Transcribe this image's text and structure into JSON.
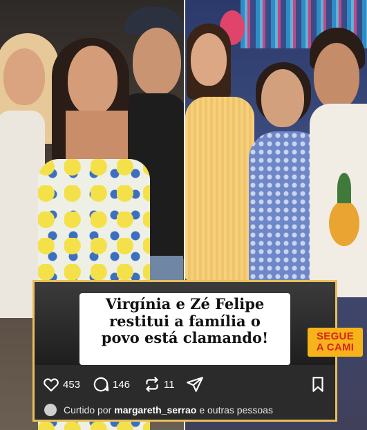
{
  "post": {
    "headline_line1": "Virgínia e Zé Felipe",
    "headline_line2": "restitui a família o",
    "headline_line3": "povo está clamando!",
    "likes": "453",
    "comments": "146",
    "reposts": "11",
    "liked_by_prefix": "Curtido por",
    "liked_by_user": "margareth_serrao",
    "liked_by_suffix": "e outras pessoas"
  },
  "badge": {
    "line1": "SEGUE",
    "line2": "A CAMI"
  },
  "colors": {
    "card_border": "#e8c05a",
    "badge_bg": "#f7b41a",
    "badge_text": "#d8231b"
  },
  "icons": [
    "heart-icon",
    "comment-icon",
    "repost-icon",
    "share-icon",
    "bookmark-icon"
  ]
}
